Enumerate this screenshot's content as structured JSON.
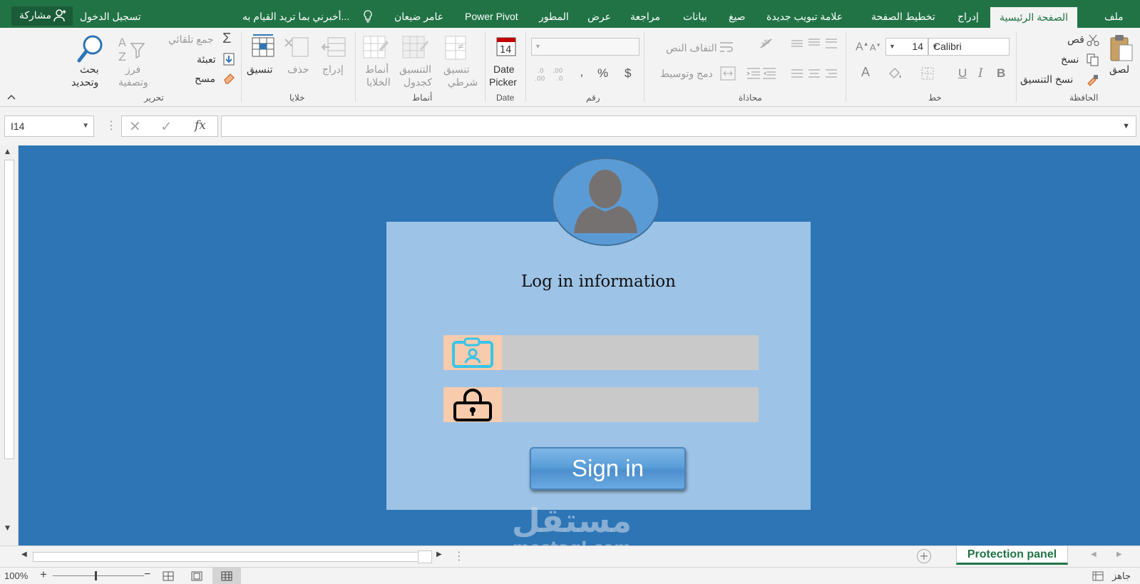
{
  "tabs": {
    "file": "ملف",
    "home": "الصفحة الرئيسية",
    "insert": "إدراج",
    "page_layout": "تخطيط الصفحة",
    "new_tab": "علامة تبويب جديدة",
    "formulas": "صيغ",
    "data": "بيانات",
    "review": "مراجعة",
    "view": "عرض",
    "developer": "المطور",
    "power_pivot": "Power Pivot",
    "user": "عامر ضيعان",
    "tell_me": "أخبرني بما تريد القيام به...",
    "sign_in": "تسجيل الدخول",
    "share": "مشاركة"
  },
  "ribbon": {
    "clipboard": {
      "label": "الحافظة",
      "paste": "لصق",
      "cut": "قص",
      "copy": "نسخ",
      "format_painter": "نسخ التنسيق"
    },
    "font": {
      "label": "خط",
      "font_name": "Calibri",
      "font_size": "14",
      "bold": "B",
      "italic": "I",
      "underline": "U"
    },
    "alignment": {
      "label": "محاذاة",
      "wrap_text": "التفاف النص",
      "merge_center": "دمج وتوسيط"
    },
    "number": {
      "label": "رقم",
      "currency": "$",
      "percent": "%",
      "comma": "‚",
      "inc_decimal": ".00\n→.0",
      "dec_decimal": ".00\n→.0"
    },
    "date": {
      "label": "Date",
      "date_picker_1": "Date",
      "date_picker_2": "Picker",
      "calendar_day": "14"
    },
    "styles": {
      "label": "أنماط",
      "conditional_1": "تنسيق",
      "conditional_2": "شرطي",
      "table_1": "التنسيق",
      "table_2": "كجدول",
      "cell_1": "أنماط",
      "cell_2": "الخلايا"
    },
    "cells": {
      "label": "خلايا",
      "insert": "إدراج",
      "delete": "حذف",
      "format": "تنسيق"
    },
    "editing": {
      "label": "تحرير",
      "autosum": "جمع تلقائي",
      "fill": "تعبئة",
      "clear": "مسح",
      "sort_1": "فرز",
      "sort_2": "وتصفية",
      "find_1": "بحث",
      "find_2": "وتحديد"
    }
  },
  "formula_bar": {
    "name_box": "I14",
    "formula": "",
    "fx": "fx"
  },
  "login": {
    "title": "Log in information",
    "username_value": "",
    "password_value": "",
    "sign_in": "Sign in"
  },
  "watermark": {
    "ar": "مستقل",
    "en": "mostaql.com"
  },
  "sheet_tabs": {
    "active": "Protection panel"
  },
  "status": {
    "ready": "جاهز",
    "zoom": "100%"
  },
  "colors": {
    "excel_green": "#217346",
    "sheet_bg": "#2e75b6",
    "panel": "#9dc3e6",
    "field": "#c9c9c9",
    "icon_bg": "#f8cbad"
  }
}
